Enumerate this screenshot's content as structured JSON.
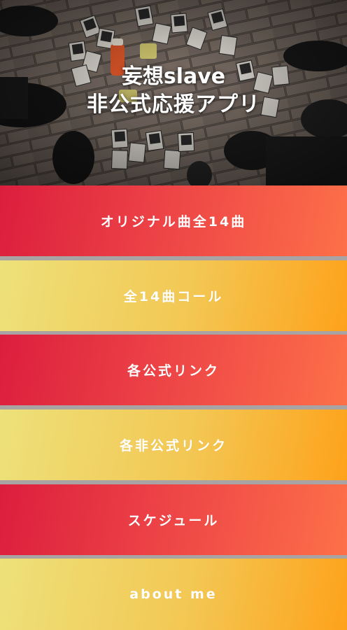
{
  "hero": {
    "title_line1": "妄想slave",
    "title_line2": "非公式応援アプリ"
  },
  "menu": [
    {
      "label": "オリジナル曲全14曲",
      "style": "red"
    },
    {
      "label": "全14曲コール",
      "style": "yellow"
    },
    {
      "label": "各公式リンク",
      "style": "red"
    },
    {
      "label": "各非公式リンク",
      "style": "yellow"
    },
    {
      "label": "スケジュール",
      "style": "red"
    },
    {
      "label": "about me",
      "style": "yellow"
    }
  ],
  "colors": {
    "red_start": "#dc1e3d",
    "red_end": "#fd7048",
    "yellow_start": "#ede17a",
    "yellow_end": "#fea21b",
    "separator": "#a9a3a4"
  }
}
